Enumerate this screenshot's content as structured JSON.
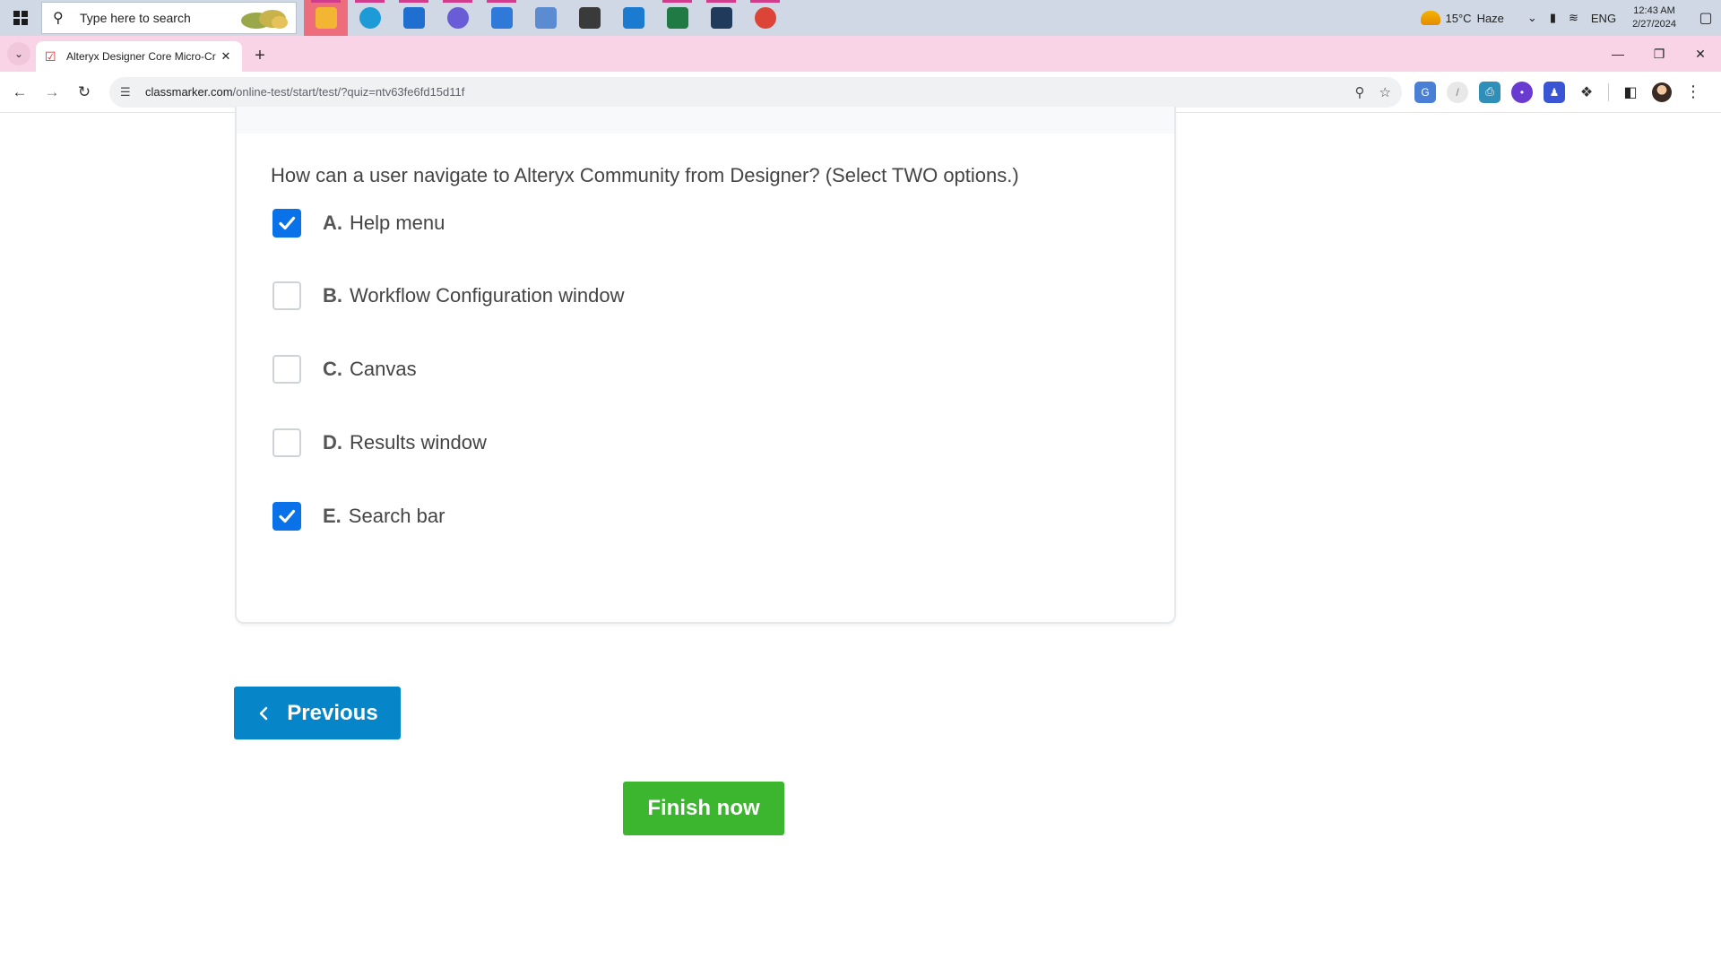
{
  "taskbar": {
    "search_placeholder": "Type here to search",
    "apps": [
      {
        "icon": "file-explorer-icon",
        "color": "#f2b632"
      },
      {
        "icon": "edge-icon",
        "color": "#1c9bd6"
      },
      {
        "icon": "mail-icon",
        "color": "#1e6fd0"
      },
      {
        "icon": "copilot-icon",
        "color": "#6a5cd6"
      },
      {
        "icon": "app-diamond-icon",
        "color": "#2f7ad9"
      },
      {
        "icon": "contact-file-icon",
        "color": "#5b8bd0"
      },
      {
        "icon": "settings-gear-icon",
        "color": "#3a3a3a"
      },
      {
        "icon": "photos-icon",
        "color": "#1a7bd0"
      },
      {
        "icon": "excel-icon",
        "color": "#1f7a43"
      },
      {
        "icon": "powershell-icon",
        "color": "#1f3a5a"
      },
      {
        "icon": "chrome-icon",
        "color": "#db4437"
      }
    ],
    "weather_temp": "15°C",
    "weather_desc": "Haze",
    "language": "ENG",
    "time": "12:43 AM",
    "date": "2/27/2024"
  },
  "browser": {
    "tab_title": "Alteryx Designer Core Micro-Cr",
    "url_host": "classmarker.com",
    "url_path": "/online-test/start/test/?quiz=ntv63fe6fd15d11f"
  },
  "quiz": {
    "question": "How can a user navigate to Alteryx Community from Designer? (Select TWO options.)",
    "options": [
      {
        "letter": "A.",
        "text": "Help menu",
        "checked": true
      },
      {
        "letter": "B.",
        "text": "Workflow Configuration window",
        "checked": false
      },
      {
        "letter": "C.",
        "text": "Canvas",
        "checked": false
      },
      {
        "letter": "D.",
        "text": "Results window",
        "checked": false
      },
      {
        "letter": "E.",
        "text": "Search bar",
        "checked": true
      }
    ],
    "previous_label": "Previous",
    "finish_label": "Finish now"
  }
}
